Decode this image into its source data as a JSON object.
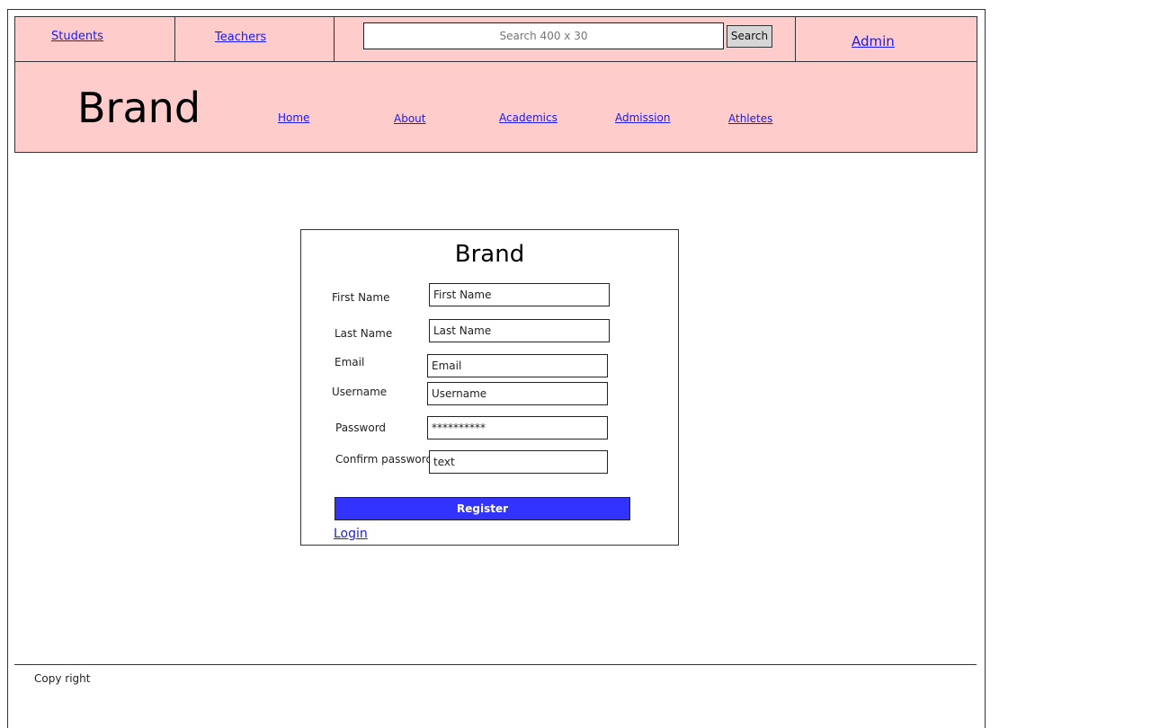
{
  "topbar": {
    "links": [
      "Students",
      "Teachers"
    ],
    "search_placeholder": "Search 400 x 30",
    "search_button": "Search",
    "admin_link": "Admin"
  },
  "navbar": {
    "brand": "Brand",
    "items": [
      "Home",
      "About",
      "Academics",
      "Admission",
      "Athletes"
    ]
  },
  "form": {
    "brand": "Brand",
    "fields": [
      {
        "label": "First Name",
        "value": "First Name"
      },
      {
        "label": "Last Name",
        "value": "Last Name"
      },
      {
        "label": "Email",
        "value": "Email"
      },
      {
        "label": "Username",
        "value": "Username"
      },
      {
        "label": "Password",
        "value": "**********"
      },
      {
        "label": "Confirm password",
        "value": "text"
      }
    ],
    "register_label": "Register",
    "login_link": "Login"
  },
  "footer": {
    "copyright": "Copy right"
  }
}
